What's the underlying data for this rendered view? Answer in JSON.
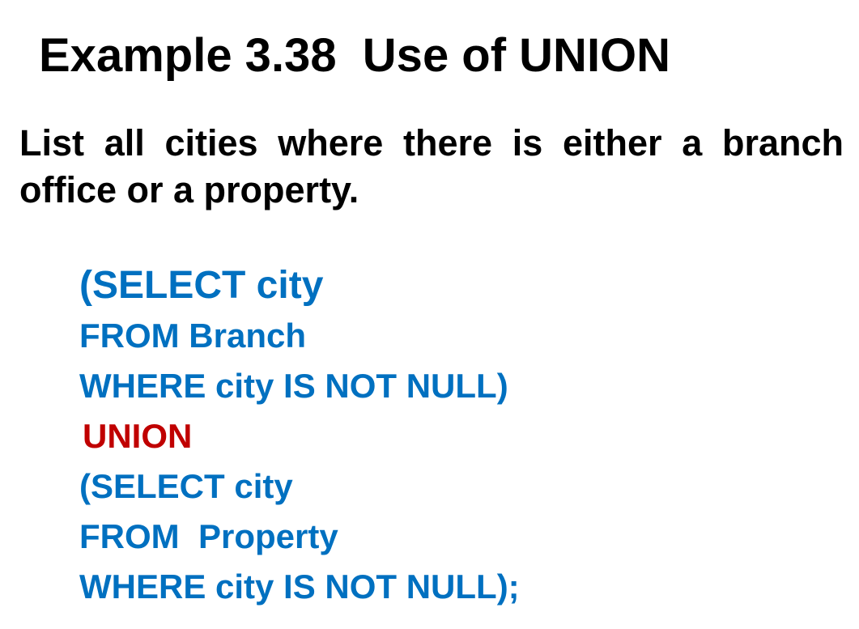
{
  "slide": {
    "title": "Example 3.38  Use of UNION",
    "question": "List all cities where there is either a branch office or  a property.",
    "sql_lines": [
      {
        "text": "(SELECT city",
        "color": "#0070C0"
      },
      {
        "text": "FROM Branch",
        "color": "#0070C0"
      },
      {
        "text": "WHERE city IS NOT NULL)",
        "color": "#0070C0"
      },
      {
        "text": "UNION",
        "color": "#C00000"
      },
      {
        "text": "(SELECT city",
        "color": "#0070C0"
      },
      {
        "text": "FROM  Property",
        "color": "#0070C0"
      },
      {
        "text": "WHERE city IS NOT NULL);",
        "color": "#0070C0"
      }
    ]
  }
}
